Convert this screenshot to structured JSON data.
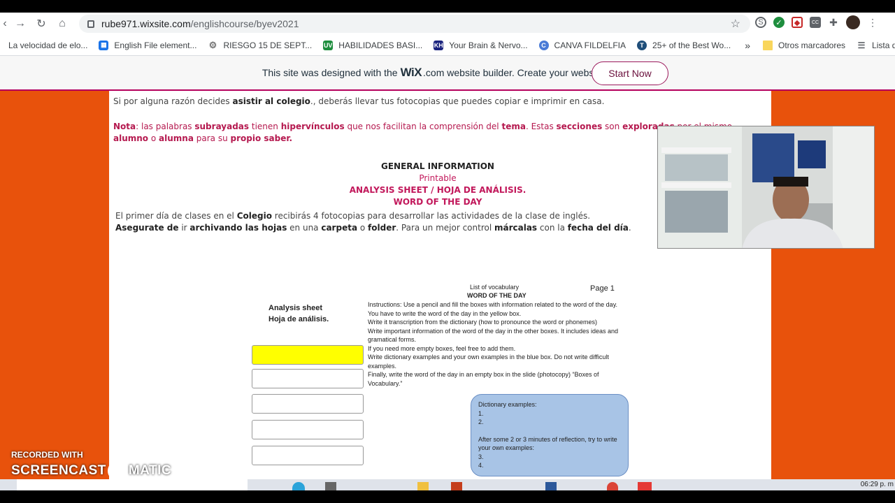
{
  "browser": {
    "url_host": "rube971.wixsite.com",
    "url_path": "/englishcourse/byev2021"
  },
  "bookmarks": [
    {
      "label": "La velocidad de elo...",
      "icon": "globe-icon",
      "color": "#9aa0a6"
    },
    {
      "label": "English File element...",
      "icon": "grid-icon",
      "color": "#1a73e8"
    },
    {
      "label": "RIESGO 15 DE SEPT...",
      "icon": "gear-icon",
      "color": "#777"
    },
    {
      "label": "HABILIDADES BASI...",
      "icon": "uv-icon",
      "color": "#1e8e3e"
    },
    {
      "label": "Your Brain & Nervo...",
      "icon": "kh-icon",
      "color": "#1a237e"
    },
    {
      "label": "CANVA FILDELFIA",
      "icon": "canva-icon",
      "color": "#4a7bd6"
    },
    {
      "label": "25+ of the Best Wo...",
      "icon": "t-icon",
      "color": "#1f4e79"
    }
  ],
  "bookmarks_more": "»",
  "other_bookmarks": "Otros marcadores",
  "reading_list": "Lista de lectura",
  "wix_banner": {
    "before": "This site was designed with the",
    "brand": "WiX",
    "after": ".com website builder. Create your website today.",
    "button": "Start Now"
  },
  "content": {
    "line1_pre": "Si por alguna razón decides ",
    "line1_bold": "asistir al colegio",
    "line1_post": "., deberás llevar tus fotocopias que puedes copiar e imprimir en casa.",
    "nota_label": "Nota",
    "nota_1": ": las palabras ",
    "nota_b1": "subrayadas",
    "nota_2": " tienen ",
    "nota_b2": "hipervínculos",
    "nota_3": " que nos facilitan la comprensión del ",
    "nota_b3": "tema",
    "nota_4": ". Estas ",
    "nota_b4": "secciones",
    "nota_5": " son ",
    "nota_b5": "exploradas",
    "nota_6": " por el mismo ",
    "nota_b6": "alumno",
    "nota_7": " o ",
    "nota_b7": "alumna",
    "nota_8": " para su ",
    "nota_b8": "propio saber.",
    "general_info": "GENERAL INFORMATION",
    "printable": "Printable",
    "analysis_title": "ANALYSIS SHEET / HOJA DE ANÁLISIS.",
    "wotd_title": "WORD OF THE DAY",
    "para1_a": "El primer día de clases en el ",
    "para1_b": "Colegio",
    "para1_c": " recibirás 4 fotocopias para desarrollar las actividades de la clase de inglés.",
    "para2_a": "Asegurate de",
    "para2_b": " ir ",
    "para2_c": "archivando las hojas",
    "para2_d": " en una ",
    "para2_e": "carpeta",
    "para2_f": " o ",
    "para2_g": "folder",
    "para2_h": ". Para un mejor control ",
    "para2_i": "márcalas",
    "para2_j": " con la ",
    "para2_k": "fecha del día",
    "para2_l": "."
  },
  "document": {
    "list_of_vocab": "List of vocabulary",
    "word_of_day": "WORD OF THE DAY",
    "page": "Page 1",
    "analysis_sheet": "Analysis sheet",
    "hoja": "Hoja de análisis.",
    "instructions": [
      "Instructions: Use a pencil and fill the boxes with information related to the word of the day.",
      "You have to write the word of the day in the yellow box.",
      "Write it transcription from the dictionary (how to pronounce the word or phonemes)",
      "Write important information of the word of the day in the other boxes. It includes ideas and gramatical forms.",
      "If you need more empty boxes, feel free to add them.",
      "Write dictionary examples and your own examples in the blue box. Do not write difficult examples.",
      "Finally, write the word of the day in an empty box in the slide (photocopy) “Boxes of Vocabulary.”"
    ],
    "dict_title": "Dictionary examples:",
    "dict_1": "1.",
    "dict_2": "2.",
    "dict_reflect": "After some 2 or 3 minutes of reflection, try to write your own examples:",
    "dict_3": "3.",
    "dict_4": "4."
  },
  "watermark": {
    "recorded": "RECORDED WITH",
    "brand_a": "SCREENCAST",
    "brand_b": "MATIC"
  },
  "clock": "06:29 p. m"
}
